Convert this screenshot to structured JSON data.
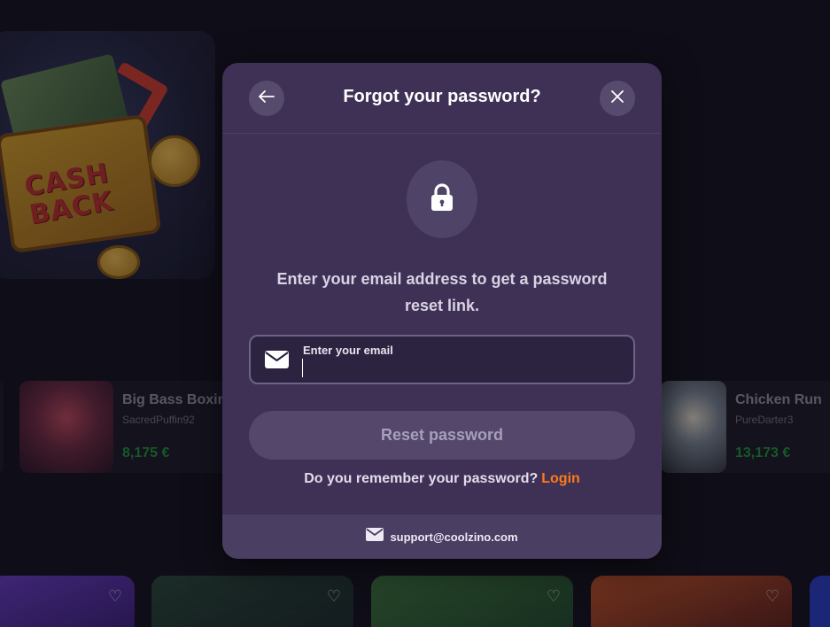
{
  "background": {
    "promo": {
      "text": "CASH BACK"
    },
    "winners": [
      {
        "game": "Big Bass Boxin",
        "user": "SacredPuffin92",
        "amount": "8,175 €"
      },
      {
        "game": "Chicken Run",
        "user": "PureDarter3",
        "amount": "13,173 €"
      }
    ],
    "game_tiles": [
      {
        "heart_icon": "heart-outline-icon"
      },
      {
        "heart_icon": "heart-outline-icon"
      },
      {
        "heart_icon": "heart-outline-icon"
      },
      {
        "heart_icon": "heart-outline-icon"
      }
    ]
  },
  "modal": {
    "title": "Forgot your password?",
    "back_icon": "arrow-left-icon",
    "close_icon": "close-icon",
    "lock_icon": "lock-icon",
    "description": "Enter your email address to get a password reset link.",
    "email_field": {
      "label": "Enter your email",
      "value": "",
      "icon": "envelope-icon"
    },
    "reset_button_label": "Reset password",
    "remember_text": "Do you remember your password?",
    "login_link": "Login",
    "support": {
      "icon": "envelope-icon",
      "email": "support@coolzino.com"
    }
  },
  "colors": {
    "page_bg": "#13111c",
    "modal_bg": "#3e3155",
    "accent_orange": "#ff7a1a",
    "winner_green": "#1f9a3a"
  }
}
